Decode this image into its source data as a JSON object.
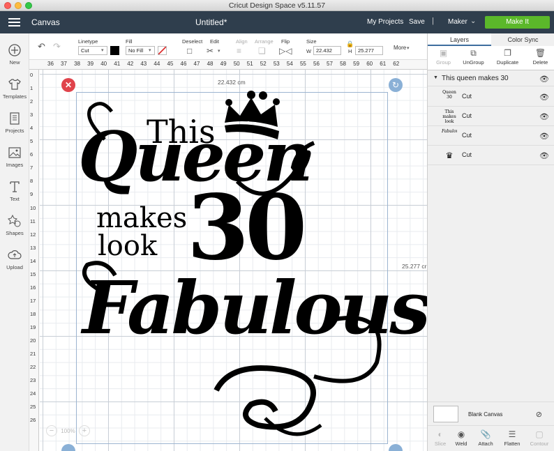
{
  "window": {
    "title": "Cricut Design Space  v5.11.57"
  },
  "header": {
    "section": "Canvas",
    "document_title": "Untitled*",
    "my_projects": "My Projects",
    "save": "Save",
    "separator": "|",
    "machine": "Maker",
    "make_it": "Make It",
    "accent_color": "#5bb82a",
    "bar_color": "#2f3e4d"
  },
  "sidebar": {
    "items": [
      {
        "label": "New",
        "icon": "plus-circle-icon"
      },
      {
        "label": "Templates",
        "icon": "shirt-icon"
      },
      {
        "label": "Projects",
        "icon": "projects-icon"
      },
      {
        "label": "Images",
        "icon": "image-icon"
      },
      {
        "label": "Text",
        "icon": "text-icon"
      },
      {
        "label": "Shapes",
        "icon": "shapes-icon"
      },
      {
        "label": "Upload",
        "icon": "upload-cloud-icon"
      }
    ]
  },
  "toolbar": {
    "linetype_label": "Linetype",
    "linetype_value": "Cut",
    "fill_label": "Fill",
    "fill_value": "No Fill",
    "deselect": "Deselect",
    "edit": "Edit",
    "align": "Align",
    "arrange": "Arrange",
    "flip": "Flip",
    "size": "Size",
    "w_label": "W",
    "w_value": "22.432",
    "h_label": "H",
    "h_value": "25.277",
    "more": "More"
  },
  "rulers": {
    "top": [
      "36",
      "37",
      "38",
      "39",
      "40",
      "41",
      "42",
      "43",
      "44",
      "45",
      "46",
      "47",
      "48",
      "49",
      "50",
      "51",
      "52",
      "53",
      "54",
      "55",
      "56",
      "57",
      "58",
      "59",
      "60",
      "61",
      "62"
    ],
    "left": [
      "0",
      "1",
      "2",
      "3",
      "4",
      "5",
      "6",
      "7",
      "8",
      "9",
      "10",
      "11",
      "12",
      "13",
      "14",
      "15",
      "16",
      "17",
      "18",
      "19",
      "20",
      "21",
      "22",
      "23",
      "24",
      "25",
      "26"
    ]
  },
  "canvas": {
    "width_label": "22.432 cm",
    "height_label": "25.277 cr",
    "zoom": "100%",
    "design_lines": {
      "this": "This",
      "queen": "Queen",
      "makes": "makes",
      "look": "look",
      "thirty": "30",
      "fabulous": "Fabulous"
    }
  },
  "panel": {
    "tabs": [
      "Layers",
      "Color Sync"
    ],
    "actions": [
      "Group",
      "UnGroup",
      "Duplicate",
      "Delete"
    ],
    "group_name": "This queen makes 30",
    "layers": [
      {
        "op": "Cut",
        "thumb": "Queen 30"
      },
      {
        "op": "Cut",
        "thumb": "This makes look"
      },
      {
        "op": "Cut",
        "thumb": "Fabulous"
      },
      {
        "op": "Cut",
        "thumb": "crown"
      }
    ],
    "blank_canvas": "Blank Canvas",
    "bottom_actions": [
      "Slice",
      "Weld",
      "Attach",
      "Flatten",
      "Contour"
    ]
  }
}
